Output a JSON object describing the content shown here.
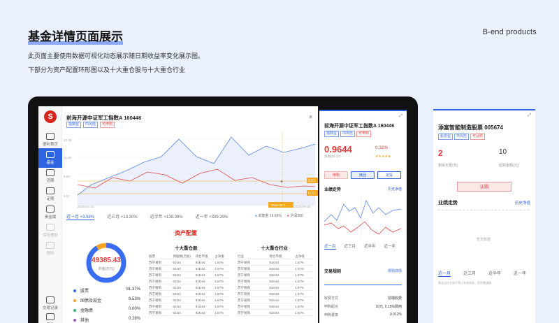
{
  "page": {
    "title": "基金详情页面展示",
    "en_label": "B-end products",
    "desc1": "此页面主要使用数据可视化动态展示随日期收益率变化展示图。",
    "desc2": "下部分为资产配置环形图以及十大重仓股与十大重仓行业"
  },
  "sidebar": [
    {
      "label": "便利首页",
      "icon": "home-icon"
    },
    {
      "label": "基金",
      "icon": "fund-icon",
      "active": true
    },
    {
      "label": "活期",
      "icon": "current-icon"
    },
    {
      "label": "定期",
      "icon": "fixed-icon"
    },
    {
      "label": "贵金属",
      "icon": "gold-icon"
    },
    {
      "label": "保险理财",
      "icon": "insurance-icon",
      "dim": true
    },
    {
      "label": "理财",
      "icon": "wealth-icon",
      "dim": true
    },
    {
      "label": "交易记录",
      "icon": "record-icon"
    },
    {
      "label": "我的",
      "icon": "user-icon"
    }
  ],
  "detail": {
    "logo": "S",
    "fund_name": "前海开源中证军工指数A 160446",
    "tags": [
      {
        "text": "指数型",
        "red": false
      },
      {
        "text": "中风险",
        "red": false
      },
      {
        "text": "可申购",
        "red": true
      }
    ],
    "close": "×",
    "marker_date": "2015-04-1",
    "x_start": "2015-03-16",
    "x_end": "2015-04-16",
    "badge1": "2.61",
    "badge2": "0.71",
    "y_labels": [
      "13.48",
      "11.16",
      "8.84",
      "9.57"
    ],
    "range_tabs": [
      {
        "label": "近一月 +3.98%",
        "on": true
      },
      {
        "label": "近三月 +13.30%",
        "on": false
      },
      {
        "label": "近半年 +139.39%",
        "on": false
      },
      {
        "label": "近一年 +339.39%",
        "on": false
      }
    ],
    "legend": [
      "本基金 16.66%",
      "沪深300"
    ]
  },
  "allocation": {
    "title": "资产配置",
    "total": "49385.43",
    "total_unit": "市值(万元)",
    "items": [
      {
        "name": "股票",
        "pct": "91.37%",
        "color": "#3a6cf0"
      },
      {
        "name": "国债及现金",
        "pct": "8.53%",
        "color": "#f5a623"
      },
      {
        "name": "金融债",
        "pct": "0.00%",
        "color": "#2bb673"
      },
      {
        "name": "其他",
        "pct": "0.28%",
        "color": "#9b59b6"
      }
    ]
  },
  "holdings": {
    "stocks_title": "十大重仓股",
    "industry_title": "十大重仓行业",
    "stock_head": [
      "股票",
      "持股数(万股)",
      "持仓市值",
      "占净值"
    ],
    "industry_head": [
      "行业",
      "持仓市值",
      "占净值"
    ],
    "stock_rows": [
      [
        "苏宁易购",
        "63.54",
        "918.64",
        "1.67%"
      ],
      [
        "苏宁易购",
        "63.54",
        "918.64",
        "1.67%"
      ],
      [
        "苏宁易购",
        "63.54",
        "918.64",
        "1.67%"
      ],
      [
        "苏宁易购",
        "63.54",
        "918.64",
        "1.67%"
      ],
      [
        "苏宁易购",
        "63.54",
        "918.64",
        "1.67%"
      ],
      [
        "苏宁易购",
        "63.54",
        "918.64",
        "1.67%"
      ],
      [
        "苏宁易购",
        "63.54",
        "918.64",
        "1.67%"
      ],
      [
        "苏宁易购",
        "63.54",
        "918.64",
        "1.67%"
      ],
      [
        "苏宁易购",
        "63.54",
        "918.64",
        "1.67%"
      ]
    ],
    "industry_rows": [
      [
        "苏宁易购",
        "918.64",
        "1.67%"
      ],
      [
        "苏宁易购",
        "918.64",
        "1.67%"
      ],
      [
        "苏宁易购",
        "918.64",
        "1.67%"
      ],
      [
        "苏宁易购",
        "918.64",
        "1.67%"
      ],
      [
        "苏宁易购",
        "918.64",
        "1.67%"
      ],
      [
        "苏宁易购",
        "918.64",
        "1.67%"
      ],
      [
        "苏宁易购",
        "918.64",
        "1.67%"
      ],
      [
        "苏宁易购",
        "918.64",
        "1.67%"
      ],
      [
        "苏宁易购",
        "918.64",
        "1.67%"
      ]
    ]
  },
  "mid_panel": {
    "fund_name": "前海开源中证军工指数A 160446",
    "tags": [
      {
        "text": "指数型",
        "red": false
      },
      {
        "text": "中风险",
        "red": false
      },
      {
        "text": "可申购",
        "red": true
      }
    ],
    "nav": "0.9644",
    "nav_sub": "净值(04-17)",
    "change": "0.32%",
    "stars": "★★★★★",
    "btn_buy": "申购",
    "btn_redeem": "赎回",
    "btn_plan": "定投",
    "trend_title": "业绩走势",
    "trend_link": "历史净值",
    "tabs": [
      {
        "label": "近一月",
        "on": true
      },
      {
        "label": "近三月",
        "on": false
      },
      {
        "label": "近半年",
        "on": false
      },
      {
        "label": "近一年",
        "on": false
      }
    ],
    "rules_title": "交易规则",
    "rules_link": "规则详情",
    "rules": [
      {
        "k": "收费方式",
        "v": "前端收费"
      },
      {
        "k": "申购起点",
        "v": "10元, 0.15%费用"
      },
      {
        "k": "申购费率",
        "v": "0.012%"
      }
    ]
  },
  "right_panel": {
    "fund_name": "添富智能制造股票 005674",
    "tags": [
      {
        "text": "股票型",
        "red": false
      },
      {
        "text": "中风险",
        "red": false
      },
      {
        "text": "可认购",
        "red": true
      }
    ],
    "stat1_value": "2",
    "stat1_label": "剩余天数(天)",
    "stat2_value": "10",
    "stat2_label": "起购金额(元)",
    "buy": "认购",
    "trend_title": "业绩走势",
    "trend_link": "历史净值",
    "no_data": "暂无数据",
    "tabs": [
      {
        "label": "近一月",
        "on": true
      },
      {
        "label": "近三月",
        "on": false
      },
      {
        "label": "近半年",
        "on": false
      },
      {
        "label": "近一年",
        "on": false
      }
    ],
    "note": "基金过往业绩不预示未来表现，投资需谨慎"
  }
}
